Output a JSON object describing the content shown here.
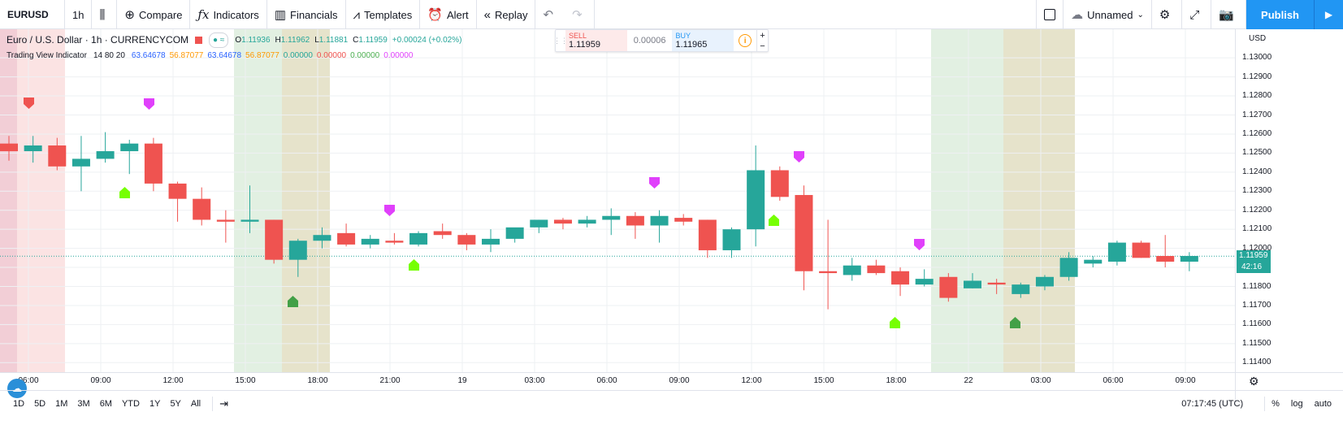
{
  "toolbar": {
    "symbol": "EURUSD",
    "interval": "1h",
    "compare": "Compare",
    "indicators": "Indicators",
    "financials": "Financials",
    "templates": "Templates",
    "alert": "Alert",
    "replay": "Replay",
    "layout_name": "Unnamed",
    "publish": "Publish"
  },
  "legend": {
    "title": "Euro / U.S. Dollar · 1h · CURRENCYCOM",
    "open": "1.11936",
    "high": "1.11962",
    "low": "1.11881",
    "close": "1.11959",
    "change": "+0.00024 (+0.02%)",
    "indicator_name": "Trading View Indicator",
    "indicator_params": "14 80 20",
    "indicator_values": [
      {
        "text": "63.64678",
        "color": "#2962ff"
      },
      {
        "text": "56.87077",
        "color": "#ff9800"
      },
      {
        "text": "63.64678",
        "color": "#2962ff"
      },
      {
        "text": "56.87077",
        "color": "#ff9800"
      },
      {
        "text": "0.00000",
        "color": "#26a69a"
      },
      {
        "text": "0.00000",
        "color": "#ef5350"
      },
      {
        "text": "0.00000",
        "color": "#4caf50"
      },
      {
        "text": "0.00000",
        "color": "#e040fb"
      }
    ]
  },
  "trade": {
    "sell_label": "SELL",
    "sell_price": "1.11959",
    "spread": "0.00006",
    "buy_label": "BUY",
    "buy_price": "1.11965"
  },
  "price_scale": {
    "unit": "USD",
    "ticks": [
      "1.13000",
      "1.12900",
      "1.12800",
      "1.12700",
      "1.12600",
      "1.12500",
      "1.12400",
      "1.12300",
      "1.12200",
      "1.12100",
      "1.12000",
      "1.11900",
      "1.11800",
      "1.11700",
      "1.11600",
      "1.11500",
      "1.11400"
    ],
    "current_price": "1.11959",
    "countdown": "42:16"
  },
  "time_axis": {
    "ticks": [
      "06:00",
      "09:00",
      "12:00",
      "15:00",
      "18:00",
      "21:00",
      "19",
      "03:00",
      "06:00",
      "09:00",
      "12:00",
      "15:00",
      "18:00",
      "22",
      "03:00",
      "06:00",
      "09:00"
    ]
  },
  "bottom": {
    "ranges": [
      "1D",
      "5D",
      "1M",
      "3M",
      "6M",
      "YTD",
      "1Y",
      "5Y",
      "All"
    ],
    "clock": "07:17:45 (UTC)",
    "percent": "%",
    "log": "log",
    "auto": "auto"
  },
  "colors": {
    "up": "#26a69a",
    "down": "#ef5350",
    "accent": "#2196f3"
  },
  "chart_data": {
    "type": "candlestick",
    "ylim": [
      1.1135,
      1.1315
    ],
    "candles": [
      {
        "o": 1.1255,
        "h": 1.1259,
        "l": 1.1246,
        "c": 1.1251
      },
      {
        "o": 1.1251,
        "h": 1.1259,
        "l": 1.1245,
        "c": 1.1254
      },
      {
        "o": 1.1254,
        "h": 1.1258,
        "l": 1.1241,
        "c": 1.1243
      },
      {
        "o": 1.1243,
        "h": 1.1259,
        "l": 1.123,
        "c": 1.1247
      },
      {
        "o": 1.1247,
        "h": 1.1261,
        "l": 1.1245,
        "c": 1.1251
      },
      {
        "o": 1.1251,
        "h": 1.1257,
        "l": 1.1239,
        "c": 1.1255
      },
      {
        "o": 1.1255,
        "h": 1.1258,
        "l": 1.123,
        "c": 1.1234
      },
      {
        "o": 1.1234,
        "h": 1.1235,
        "l": 1.1214,
        "c": 1.1226
      },
      {
        "o": 1.1226,
        "h": 1.1232,
        "l": 1.1212,
        "c": 1.1215
      },
      {
        "o": 1.1215,
        "h": 1.122,
        "l": 1.1203,
        "c": 1.1214
      },
      {
        "o": 1.1214,
        "h": 1.1233,
        "l": 1.1208,
        "c": 1.1215
      },
      {
        "o": 1.1215,
        "h": 1.1215,
        "l": 1.1192,
        "c": 1.1194
      },
      {
        "o": 1.1194,
        "h": 1.1205,
        "l": 1.1185,
        "c": 1.1204
      },
      {
        "o": 1.1204,
        "h": 1.1211,
        "l": 1.12,
        "c": 1.1207
      },
      {
        "o": 1.1208,
        "h": 1.1213,
        "l": 1.1201,
        "c": 1.1202
      },
      {
        "o": 1.1202,
        "h": 1.1207,
        "l": 1.12,
        "c": 1.1205
      },
      {
        "o": 1.1204,
        "h": 1.1208,
        "l": 1.1202,
        "c": 1.1203
      },
      {
        "o": 1.1202,
        "h": 1.1209,
        "l": 1.1201,
        "c": 1.1208
      },
      {
        "o": 1.1209,
        "h": 1.1213,
        "l": 1.1205,
        "c": 1.1207
      },
      {
        "o": 1.1207,
        "h": 1.1208,
        "l": 1.1199,
        "c": 1.1202
      },
      {
        "o": 1.1202,
        "h": 1.121,
        "l": 1.1198,
        "c": 1.1205
      },
      {
        "o": 1.1205,
        "h": 1.121,
        "l": 1.1203,
        "c": 1.1211
      },
      {
        "o": 1.1211,
        "h": 1.1215,
        "l": 1.1208,
        "c": 1.1215
      },
      {
        "o": 1.1215,
        "h": 1.1216,
        "l": 1.121,
        "c": 1.1213
      },
      {
        "o": 1.1213,
        "h": 1.1217,
        "l": 1.1211,
        "c": 1.1215
      },
      {
        "o": 1.1215,
        "h": 1.1221,
        "l": 1.1207,
        "c": 1.1217
      },
      {
        "o": 1.1217,
        "h": 1.1219,
        "l": 1.1205,
        "c": 1.1212
      },
      {
        "o": 1.1212,
        "h": 1.122,
        "l": 1.1203,
        "c": 1.1217
      },
      {
        "o": 1.1216,
        "h": 1.1218,
        "l": 1.1212,
        "c": 1.1214
      },
      {
        "o": 1.1215,
        "h": 1.1215,
        "l": 1.1195,
        "c": 1.1199
      },
      {
        "o": 1.1199,
        "h": 1.1211,
        "l": 1.1195,
        "c": 1.121
      },
      {
        "o": 1.121,
        "h": 1.1254,
        "l": 1.1201,
        "c": 1.1241
      },
      {
        "o": 1.1241,
        "h": 1.1243,
        "l": 1.1225,
        "c": 1.1227
      },
      {
        "o": 1.1228,
        "h": 1.1233,
        "l": 1.1178,
        "c": 1.1188
      },
      {
        "o": 1.1188,
        "h": 1.1215,
        "l": 1.1168,
        "c": 1.1187
      },
      {
        "o": 1.1186,
        "h": 1.1195,
        "l": 1.1183,
        "c": 1.1191
      },
      {
        "o": 1.1191,
        "h": 1.1194,
        "l": 1.1186,
        "c": 1.1187
      },
      {
        "o": 1.1188,
        "h": 1.119,
        "l": 1.1175,
        "c": 1.1181
      },
      {
        "o": 1.1181,
        "h": 1.1189,
        "l": 1.118,
        "c": 1.1184
      },
      {
        "o": 1.1185,
        "h": 1.1187,
        "l": 1.1172,
        "c": 1.1174
      },
      {
        "o": 1.1179,
        "h": 1.1187,
        "l": 1.1179,
        "c": 1.1183
      },
      {
        "o": 1.1182,
        "h": 1.1184,
        "l": 1.1176,
        "c": 1.1181
      },
      {
        "o": 1.1176,
        "h": 1.1182,
        "l": 1.1174,
        "c": 1.1181
      },
      {
        "o": 1.118,
        "h": 1.1186,
        "l": 1.1178,
        "c": 1.1185
      },
      {
        "o": 1.1185,
        "h": 1.1198,
        "l": 1.1183,
        "c": 1.1195
      },
      {
        "o": 1.1192,
        "h": 1.1196,
        "l": 1.119,
        "c": 1.1194
      },
      {
        "o": 1.1193,
        "h": 1.1204,
        "l": 1.1191,
        "c": 1.1203
      },
      {
        "o": 1.1203,
        "h": 1.1204,
        "l": 1.1195,
        "c": 1.1195
      },
      {
        "o": 1.1196,
        "h": 1.1207,
        "l": 1.119,
        "c": 1.1193
      },
      {
        "o": 1.1193,
        "h": 1.1198,
        "l": 1.1188,
        "c": 1.1196
      }
    ]
  }
}
